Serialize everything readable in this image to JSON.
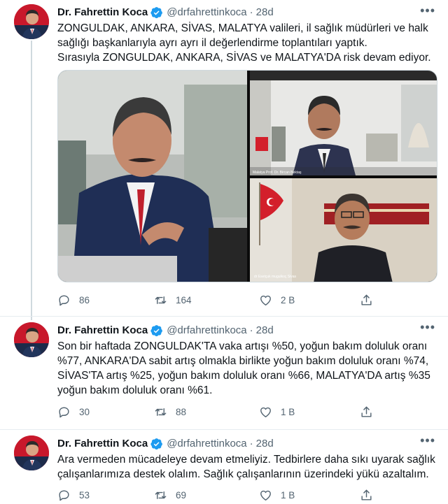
{
  "tweets": [
    {
      "author": "Dr. Fahrettin Koca",
      "handle": "@drfahrettinkoca",
      "separator": "·",
      "time": "28d",
      "text": "ZONGULDAK, ANKARA, SİVAS, MALATYA valileri, il sağlık müdürleri ve halk sağlığı başkanlarıyla ayrı ayrı il değerlendirme toplantıları yaptık.\nSırasıyla ZONGULDAK, ANKARA, SİVAS ve MALATYA'DA risk devam ediyor.",
      "replies": "86",
      "retweets": "164",
      "likes": "2 B",
      "media": {
        "caption_top": "Malatya Prof. Dr. Bircan Bektaş",
        "caption_bottom": "dr Esetçuk mugulkoç Sivas"
      }
    },
    {
      "author": "Dr. Fahrettin Koca",
      "handle": "@drfahrettinkoca",
      "separator": "·",
      "time": "28d",
      "text": "Son bir haftada ZONGULDAK'TA  vaka artışı %50, yoğun bakım doluluk oranı %77, ANKARA'DA sabit artış olmakla birlikte yoğun bakım doluluk oranı %74, SİVAS'TA artış %25, yoğun bakım doluluk oranı %66, MALATYA'DA artış  %35 yoğun bakım doluluk oranı %61.",
      "replies": "30",
      "retweets": "88",
      "likes": "1 B"
    },
    {
      "author": "Dr. Fahrettin Koca",
      "handle": "@drfahrettinkoca",
      "separator": "·",
      "time": "28d",
      "text": "Ara vermeden mücadeleye devam etmeliyiz. Tedbirlere daha sıkı uyarak sağlık çalışanlarımıza destek olalım. Sağlık çalışanlarının üzerindeki yükü azaltalım.",
      "replies": "53",
      "retweets": "69",
      "likes": "1 B"
    }
  ],
  "colors": {
    "text": "#0f1419",
    "secondary": "#536471",
    "verified": "#1d9bf0",
    "divider": "#e6ecf0",
    "avatar_bg": "#c8182b"
  },
  "icons": [
    "more-icon",
    "verified-icon",
    "reply-icon",
    "retweet-icon",
    "like-icon",
    "share-icon"
  ]
}
